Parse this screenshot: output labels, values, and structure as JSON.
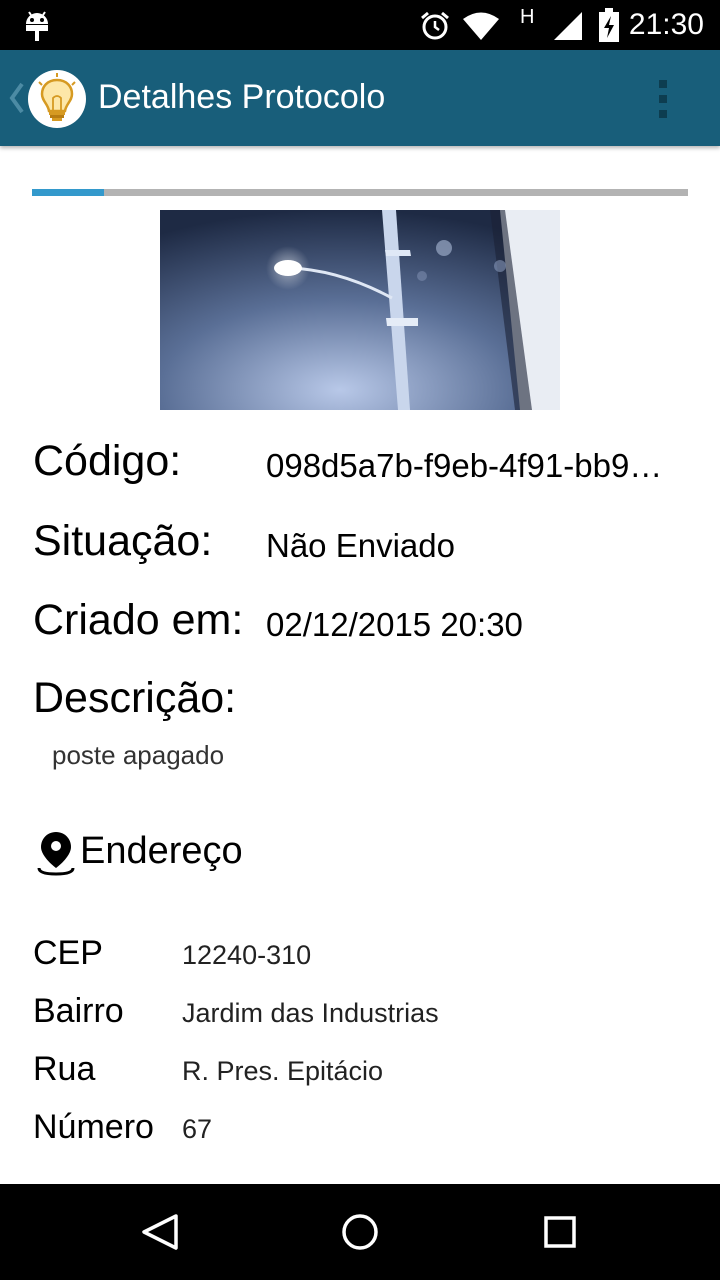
{
  "status_bar": {
    "time": "21:30",
    "network_label": "H",
    "icons": [
      "android-icon",
      "alarm-icon",
      "wifi-icon",
      "signal-icon",
      "battery-charging-icon"
    ]
  },
  "action_bar": {
    "title": "Detalhes Protocolo",
    "icons": [
      "back-chevron-icon",
      "lightbulb-logo-icon",
      "overflow-menu-icon"
    ],
    "color": "#185e7a"
  },
  "progress": {
    "value_fraction": 0.11,
    "fill_color": "#3399cc",
    "track_color": "#b3b3b3"
  },
  "photo": {
    "subject": "street lamp at night"
  },
  "details": {
    "codigo_label": "Código:",
    "codigo_value": "098d5a7b-f9eb-4f91-bb9…",
    "situacao_label": "Situação:",
    "situacao_value": "Não Enviado",
    "criado_label": "Criado em:",
    "criado_value": "02/12/2015 20:30",
    "descricao_label": "Descrição:",
    "descricao_value": "poste apagado"
  },
  "address": {
    "title": "Endereço",
    "icon": "map-pin-icon",
    "cep_label": "CEP",
    "cep_value": "12240-310",
    "bairro_label": "Bairro",
    "bairro_value": "Jardim das Industrias",
    "rua_label": "Rua",
    "rua_value": "R. Pres. Epitácio",
    "numero_label": "Número",
    "numero_value": "67"
  },
  "nav_bar": {
    "icons": [
      "back-triangle-icon",
      "home-circle-icon",
      "recents-square-icon"
    ]
  }
}
